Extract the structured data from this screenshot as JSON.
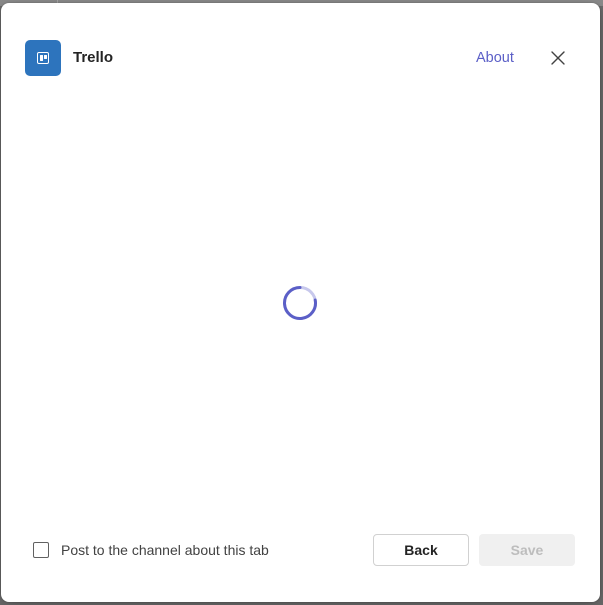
{
  "header": {
    "app_name": "Trello",
    "about_label": "About",
    "app_icon": "trello-board-icon",
    "close_icon": "close-icon"
  },
  "main": {
    "loading_indicator": "spinner-icon"
  },
  "footer": {
    "post_checkbox_label": "Post to the channel about this tab",
    "post_checkbox_checked": false,
    "back_label": "Back",
    "save_label": "Save",
    "save_enabled": false
  },
  "colors": {
    "accent": "#5b5fc7",
    "app_icon_bg": "#2d74bd",
    "disabled_bg": "#f0f0f0",
    "disabled_text": "#bdbdbd"
  }
}
